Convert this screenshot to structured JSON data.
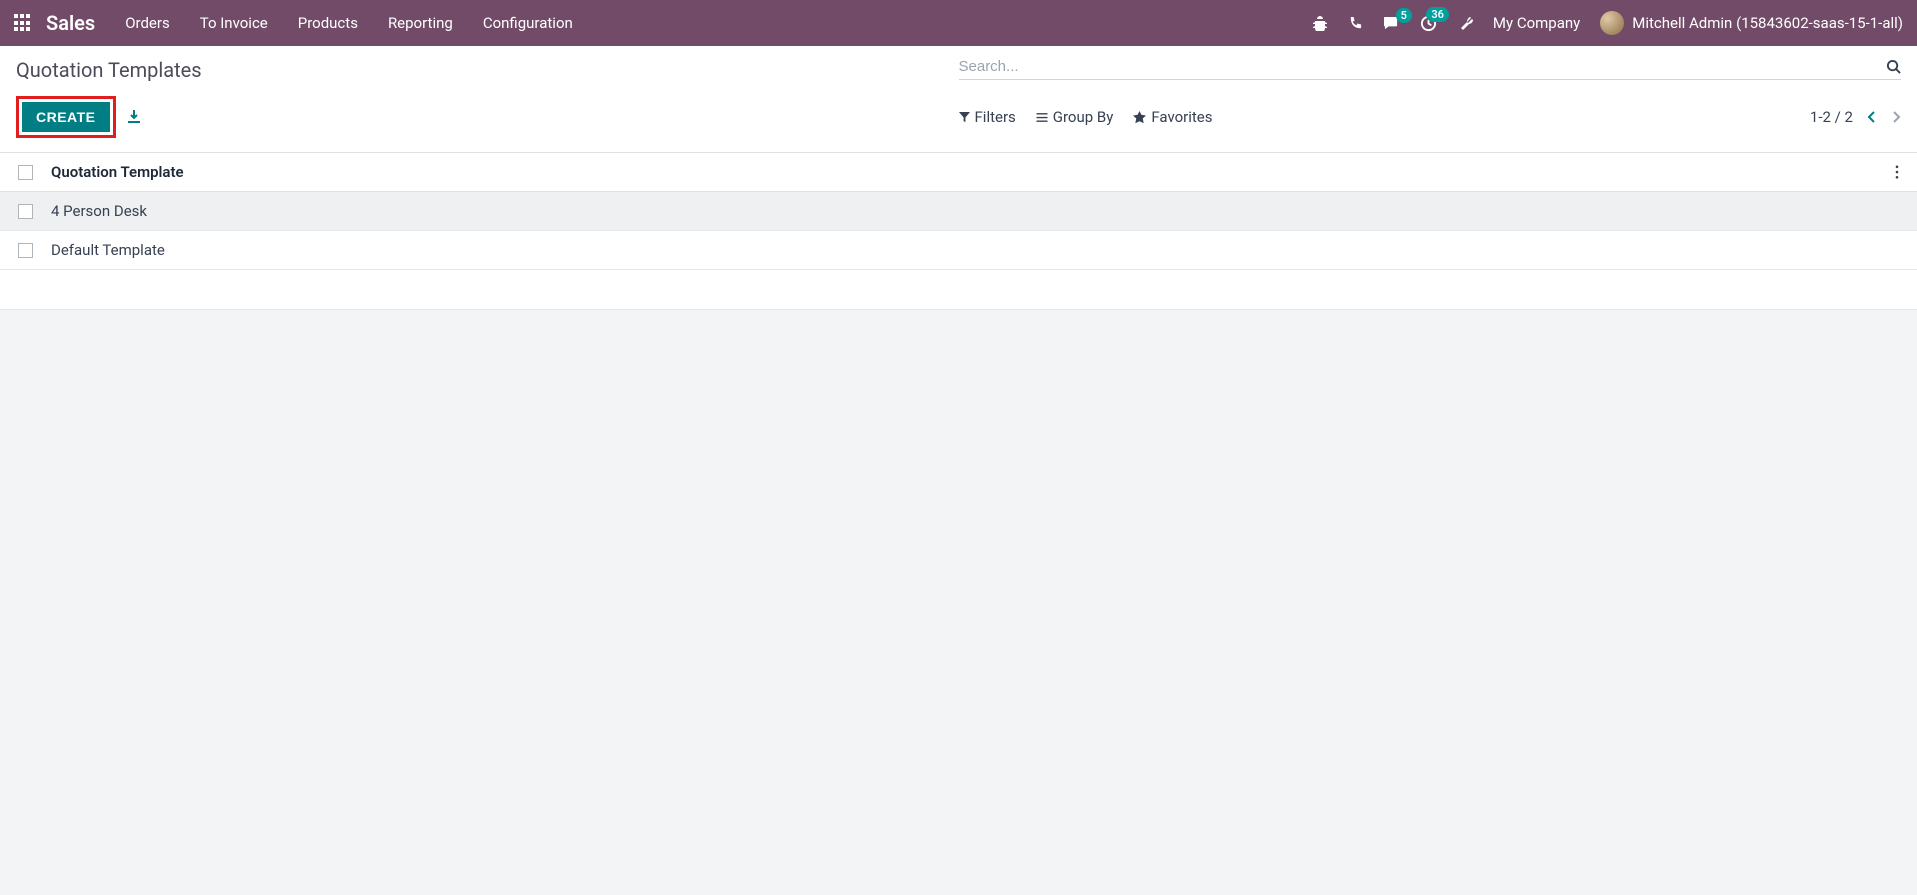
{
  "topbar": {
    "brand": "Sales",
    "nav": [
      "Orders",
      "To Invoice",
      "Products",
      "Reporting",
      "Configuration"
    ],
    "badges": {
      "chat": "5",
      "clock": "36"
    },
    "company": "My Company",
    "user": "Mitchell Admin (15843602-saas-15-1-all)"
  },
  "page": {
    "title": "Quotation Templates",
    "create_label": "CREATE",
    "search_placeholder": "Search..."
  },
  "filters": {
    "filters_label": "Filters",
    "groupby_label": "Group By",
    "favorites_label": "Favorites"
  },
  "pager": {
    "text": "1-2 / 2"
  },
  "table": {
    "header": "Quotation Template",
    "rows": [
      {
        "name": "4 Person Desk",
        "selected": true
      },
      {
        "name": "Default Template",
        "selected": false
      }
    ]
  }
}
